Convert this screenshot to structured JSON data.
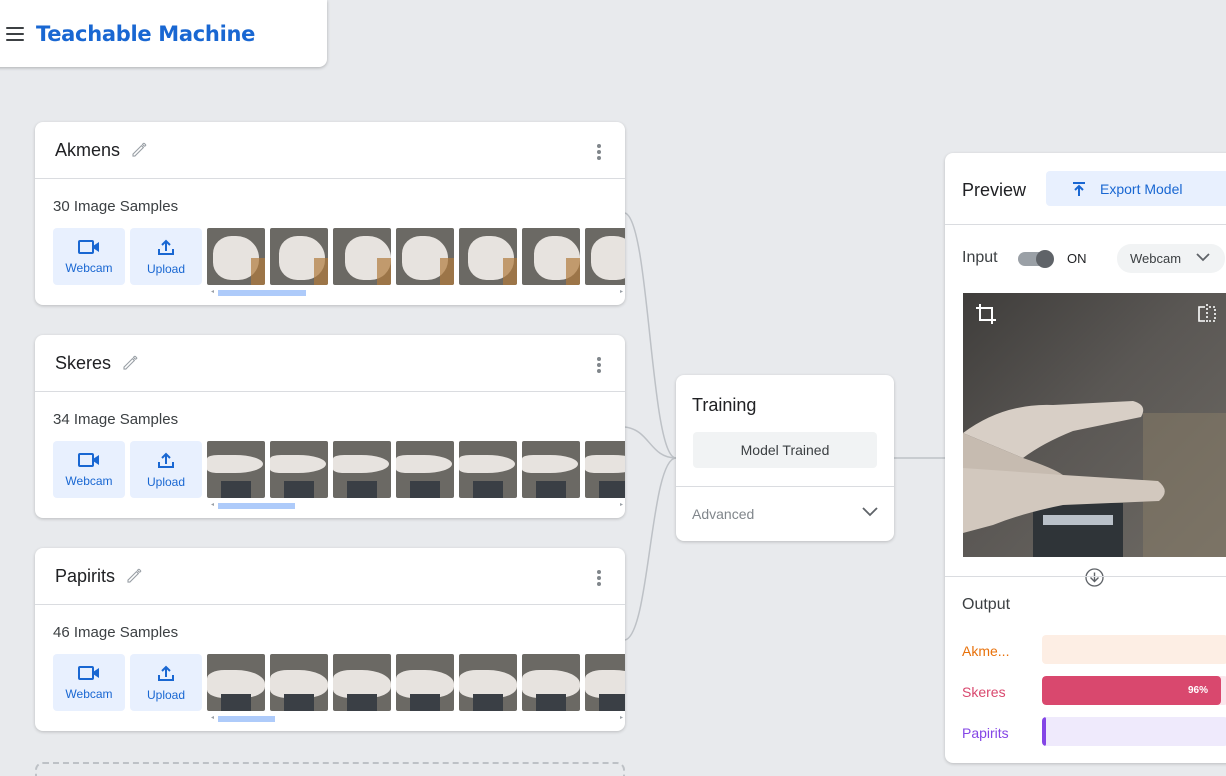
{
  "app": {
    "title": "Teachable Machine"
  },
  "classes": [
    {
      "name": "Akmens",
      "sample_count": "30 Image Samples",
      "webcam_label": "Webcam",
      "upload_label": "Upload",
      "pose": "fist"
    },
    {
      "name": "Skeres",
      "sample_count": "34 Image Samples",
      "webcam_label": "Webcam",
      "upload_label": "Upload",
      "pose": "fingers"
    },
    {
      "name": "Papirits",
      "sample_count": "46 Image Samples",
      "webcam_label": "Webcam",
      "upload_label": "Upload",
      "pose": "flat"
    }
  ],
  "training": {
    "title": "Training",
    "button_label": "Model Trained",
    "advanced_label": "Advanced"
  },
  "preview": {
    "title": "Preview",
    "export_label": "Export Model",
    "input_label": "Input",
    "toggle_state": "ON",
    "source_select": "Webcam",
    "output_label": "Output",
    "outputs": [
      {
        "label": "Akme...",
        "percent": 0,
        "color": "#e8710a",
        "bar_bg": "#fdeee4"
      },
      {
        "label": "Skeres",
        "percent": 96,
        "percent_label": "96%",
        "color": "#d9486e",
        "bar_bg": "#fbe6ec"
      },
      {
        "label": "Papirits",
        "percent": 2,
        "color": "#8446e6",
        "bar_bg": "#efeafc"
      }
    ]
  },
  "colors": {
    "brand": "#1967d2",
    "button_bg": "#e8f0fe",
    "background": "#e8eaed"
  }
}
